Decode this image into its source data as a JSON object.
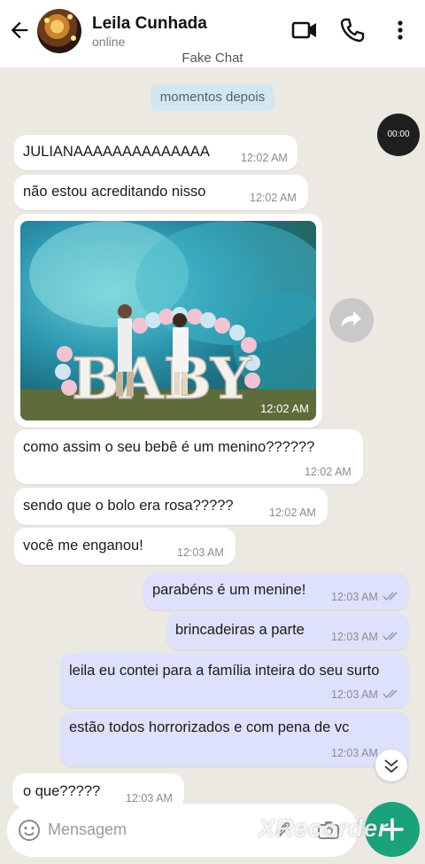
{
  "header": {
    "contact_name": "Leila Cunhada",
    "status": "online",
    "subtitle": "Fake Chat",
    "icons": [
      "back-arrow-icon",
      "video-call-icon",
      "phone-icon",
      "more-vertical-icon"
    ]
  },
  "system_pill": "momentos depois",
  "recording_timer": "00:00",
  "messages": [
    {
      "dir": "in",
      "text": "JULIANAAAAAAAAAAAAAA",
      "time": "12:02 AM"
    },
    {
      "dir": "in",
      "text": "não estou acreditando nisso",
      "time": "12:02 AM"
    },
    {
      "dir": "in",
      "type": "image",
      "time": "12:02 AM",
      "caption_in_image": "BABY"
    },
    {
      "dir": "in",
      "text": "como assim o seu bebê é um menino??????",
      "time": "12:02 AM"
    },
    {
      "dir": "in",
      "text": "sendo que o bolo era rosa?????",
      "time": "12:02 AM"
    },
    {
      "dir": "in",
      "text": "você me enganou!",
      "time": "12:03 AM"
    },
    {
      "dir": "out",
      "text": "parabéns é um menine!",
      "time": "12:03 AM"
    },
    {
      "dir": "out",
      "text": "brincadeiras a parte",
      "time": "12:03 AM"
    },
    {
      "dir": "out",
      "text": "leila eu contei para a família inteira do seu surto",
      "time": "12:03 AM"
    },
    {
      "dir": "out",
      "text": "estão todos horrorizados e com pena de vc",
      "time": "12:03 AM"
    },
    {
      "dir": "in",
      "text": "o que?????",
      "time": "12:03 AM"
    }
  ],
  "composer": {
    "placeholder": "Mensagem"
  },
  "watermark": "XRecorder",
  "colors": {
    "incoming": "#ffffff",
    "outgoing": "#dde1fb",
    "fab": "#1aa37a",
    "background": "#ece9e2"
  }
}
